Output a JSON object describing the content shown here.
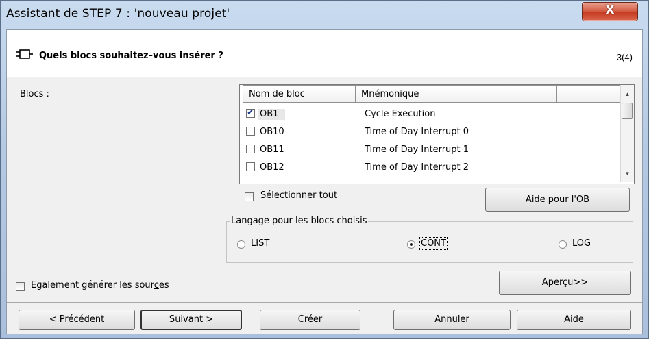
{
  "window": {
    "title": "Assistant de STEP 7 : 'nouveau projet'",
    "close_label": "X"
  },
  "header": {
    "question": "Quels blocs souhaitez–vous insérer ?",
    "step": "3(4)"
  },
  "blocks": {
    "label": "Blocs :",
    "columns": [
      "Nom de bloc",
      "Mnémonique",
      ""
    ],
    "rows": [
      {
        "checked": true,
        "name": "OB1",
        "mnemonic": "Cycle Execution"
      },
      {
        "checked": false,
        "name": "OB10",
        "mnemonic": "Time of Day Interrupt 0"
      },
      {
        "checked": false,
        "name": "OB11",
        "mnemonic": "Time of Day Interrupt 1"
      },
      {
        "checked": false,
        "name": "OB12",
        "mnemonic": "Time of Day Interrupt 2"
      }
    ],
    "select_all": {
      "checked": false,
      "label_before": "Sélectionner to",
      "label_underline": "u",
      "label_after": "t"
    },
    "help_ob": {
      "before": "Aide pour l'",
      "underline": "O",
      "after": "B"
    }
  },
  "language": {
    "legend": "Langage pour les blocs choisis",
    "options": [
      {
        "before": "",
        "underline": "L",
        "after": "IST",
        "selected": false
      },
      {
        "before": "",
        "underline": "C",
        "after": "ONT",
        "selected": true
      },
      {
        "before": "LO",
        "underline": "G",
        "after": "",
        "selected": false
      }
    ]
  },
  "generate_sources": {
    "checked": false,
    "before": "Egalement générer les sour",
    "underline": "c",
    "after": "es"
  },
  "preview": {
    "before": "",
    "underline": "A",
    "after": "perçu>>"
  },
  "buttons": {
    "previous": {
      "before": "< ",
      "underline": "P",
      "after": "récédent"
    },
    "next": {
      "before": "",
      "underline": "S",
      "after": "uivant >"
    },
    "create": {
      "before": "C",
      "underline": "r",
      "after": "éer"
    },
    "cancel": "Annuler",
    "help": "Aide"
  },
  "colors": {
    "accent": "#1d3f8c",
    "close_button": "#c3391f"
  }
}
